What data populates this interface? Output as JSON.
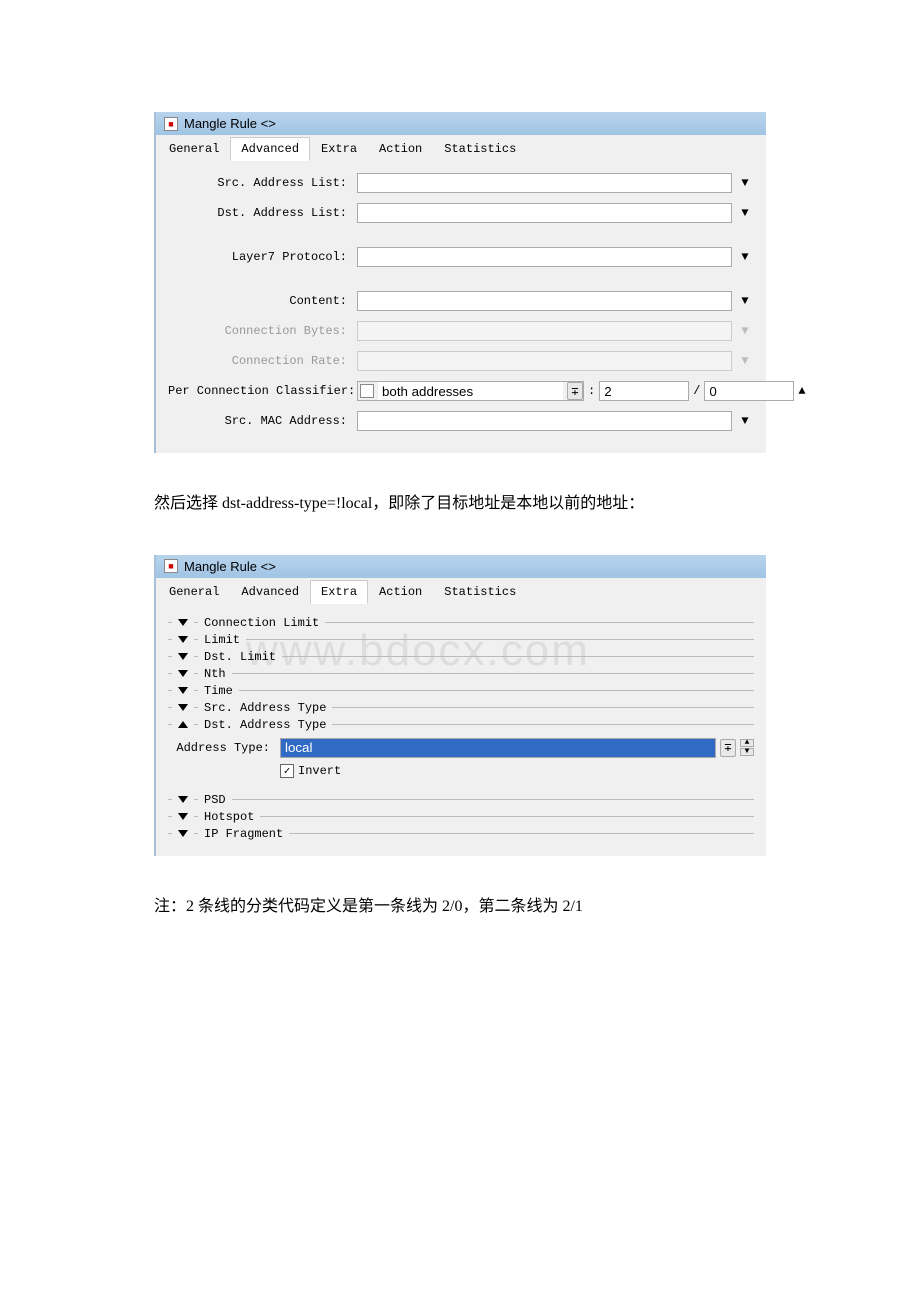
{
  "window1": {
    "title": "Mangle Rule <>",
    "activeTab": "Advanced",
    "tabs": [
      "General",
      "Advanced",
      "Extra",
      "Action",
      "Statistics"
    ],
    "fields": {
      "srcAddrList": {
        "label": "Src. Address List:",
        "value": ""
      },
      "dstAddrList": {
        "label": "Dst. Address List:",
        "value": ""
      },
      "layer7": {
        "label": "Layer7 Protocol:",
        "value": ""
      },
      "content": {
        "label": "Content:",
        "value": ""
      },
      "connBytes": {
        "label": "Connection Bytes:",
        "value": ""
      },
      "connRate": {
        "label": "Connection Rate:",
        "value": ""
      },
      "pcc": {
        "label": "Per Connection Classifier:",
        "selector": "both addresses",
        "num1": "2",
        "num2": "0"
      },
      "srcMac": {
        "label": "Src. MAC Address:",
        "value": ""
      }
    }
  },
  "narrative1": "然后选择 dst-address-type=!local，即除了目标地址是本地以前的地址：",
  "window2": {
    "title": "Mangle Rule <>",
    "activeTab": "Extra",
    "tabs": [
      "General",
      "Advanced",
      "Extra",
      "Action",
      "Statistics"
    ],
    "watermark": "www.bdocx.com",
    "sections": {
      "connLimit": "Connection Limit",
      "limit": "Limit",
      "dstLimit": "Dst. Limit",
      "nth": "Nth",
      "time": "Time",
      "srcAddrType": "Src. Address Type",
      "dstAddrType": {
        "title": "Dst. Address Type",
        "addrTypeLabel": "Address Type:",
        "addrTypeValue": "local",
        "invertLabel": "Invert",
        "invertChecked": true
      },
      "psd": "PSD",
      "hotspot": "Hotspot",
      "ipFragment": "IP Fragment"
    }
  },
  "narrative2": "注：2 条线的分类代码定义是第一条线为 2/0，第二条线为 2/1"
}
